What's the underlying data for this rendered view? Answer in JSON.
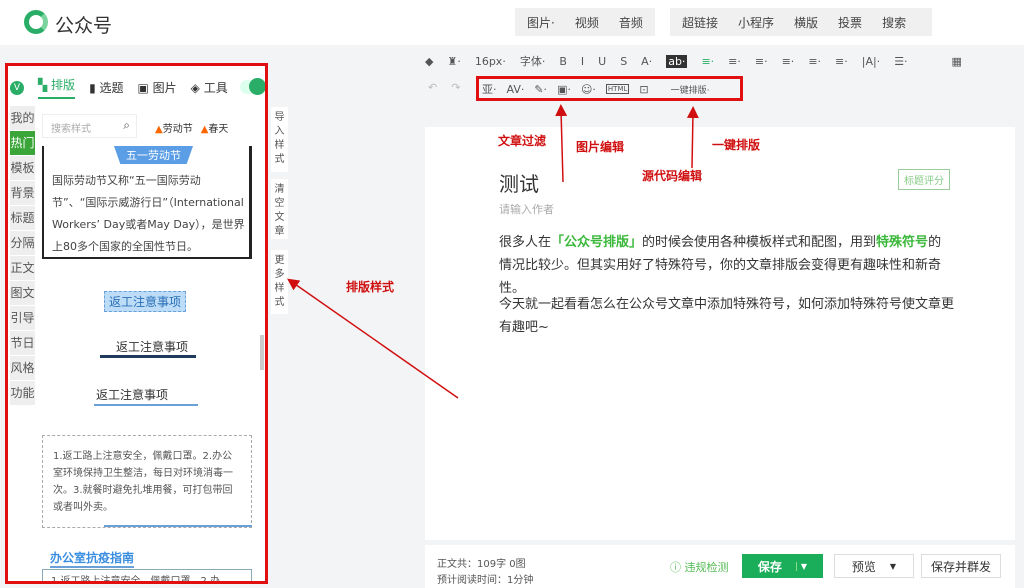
{
  "header": {
    "app_title": "公众号",
    "media_group": [
      "图片·",
      "视频",
      "音频"
    ],
    "insert_group": [
      "超链接",
      "小程序",
      "横版",
      "投票",
      "搜索"
    ]
  },
  "toolbar": {
    "row1": [
      "16px·",
      "字体·",
      "B",
      "I",
      "U",
      "S",
      "A·",
      "ab·",
      "≡·",
      "≡·",
      "≡·",
      "≡·",
      "≡·",
      "≡·",
      "|A|·",
      "☰·"
    ],
    "row2": [
      "亚·",
      "AV·",
      "✎·",
      "▣·",
      "☺·",
      "HTML",
      "⊡"
    ],
    "one_click": "一键排版·"
  },
  "left_panel": {
    "tabs": [
      "排版",
      "选题",
      "图片",
      "工具"
    ],
    "side_tabs": [
      "我的",
      "热门",
      "模板",
      "背景",
      "标题",
      "分隔",
      "正文",
      "图文",
      "引导",
      "节日",
      "风格",
      "功能"
    ],
    "search_placeholder": "搜索样式",
    "hot_tags": [
      "劳动节",
      "春天"
    ],
    "labor_badge": "五一劳动节",
    "labor_text": "国际劳动节又称“五一国际劳动节”、“国际示威游行日”（International Workers’ Day或者May Day），是世界上80多个国家的全国性节日。",
    "style_titles": [
      "返工注意事项",
      "返工注意事项",
      "返工注意事项"
    ],
    "notice_text": "1.返工路上注意安全，佩戴口罩。2.办公室环境保持卫生整洁，每日对环境消毒一次。3.就餐时避免扎堆用餐，可打包带回或者叫外卖。",
    "guide_title": "办公室抗疫指南",
    "guide_text": "1.返工路上注意安全，佩戴口罩。2.办"
  },
  "side_strip": [
    "导入样式",
    "清空文章",
    "更多样式"
  ],
  "annotations": {
    "filter": "文章过滤",
    "image_edit": "图片编辑",
    "one_click": "一键排版",
    "source_edit": "源代码编辑",
    "style": "排版样式"
  },
  "editor": {
    "title": "测试",
    "author_placeholder": "请输入作者",
    "title_score": "标题评分",
    "p1_a": "很多人在",
    "p1_b": "「公众号排版」",
    "p1_c": "的时候会使用各种模板样式和配图，用到",
    "p1_d": "特殊符号",
    "p1_e": "的情况比较少。但其实用好了特殊符号，你的文章排版会变得更有趣味性和新奇性。",
    "p2": "今天就一起看看怎么在公众号文章中添加特殊符号，如何添加特殊符号使文章更有趣吧~"
  },
  "footer": {
    "word_count": "正文共：109字 0图",
    "read_time": "预计阅读时间：1分钟",
    "check": "违规检测",
    "save": "保存",
    "preview": "预览",
    "publish": "保存并群发"
  }
}
